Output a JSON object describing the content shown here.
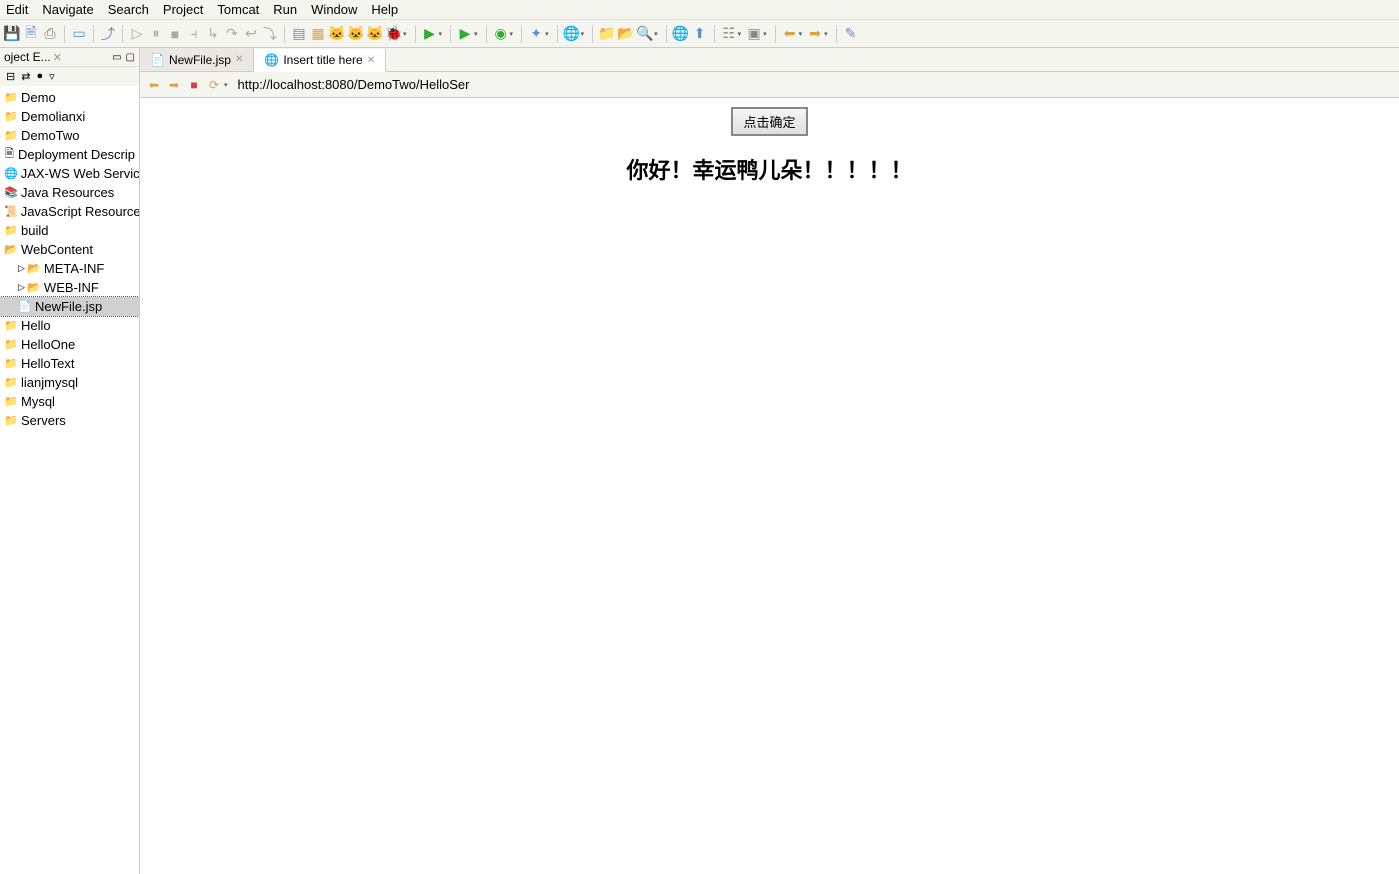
{
  "menu": [
    "Edit",
    "Navigate",
    "Search",
    "Project",
    "Tomcat",
    "Run",
    "Window",
    "Help"
  ],
  "sidebar": {
    "title": "oject E...",
    "items": [
      {
        "label": "Demo",
        "indent": 0,
        "icon": "proj"
      },
      {
        "label": "Demolianxi",
        "indent": 0,
        "icon": "proj"
      },
      {
        "label": "DemoTwo",
        "indent": 0,
        "icon": "proj"
      },
      {
        "label": "Deployment Descrip",
        "indent": 0,
        "icon": "desc"
      },
      {
        "label": "JAX-WS Web Servic",
        "indent": 0,
        "icon": "ws"
      },
      {
        "label": "Java Resources",
        "indent": 0,
        "icon": "java"
      },
      {
        "label": "JavaScript Resource",
        "indent": 0,
        "icon": "js"
      },
      {
        "label": "build",
        "indent": 0,
        "icon": "folder"
      },
      {
        "label": "WebContent",
        "indent": 0,
        "icon": "folder-open"
      },
      {
        "label": "META-INF",
        "indent": 1,
        "icon": "folder-e",
        "pre": "▷"
      },
      {
        "label": "WEB-INF",
        "indent": 1,
        "icon": "folder-e",
        "pre": "▷"
      },
      {
        "label": "NewFile.jsp",
        "indent": 1,
        "icon": "file",
        "selected": true
      },
      {
        "label": "Hello",
        "indent": 0,
        "icon": "proj"
      },
      {
        "label": "HelloOne",
        "indent": 0,
        "icon": "proj"
      },
      {
        "label": "HelloText",
        "indent": 0,
        "icon": "proj"
      },
      {
        "label": "lianjmysql",
        "indent": 0,
        "icon": "proj"
      },
      {
        "label": "Mysql",
        "indent": 0,
        "icon": "proj"
      },
      {
        "label": "Servers",
        "indent": 0,
        "icon": "proj"
      }
    ]
  },
  "tabs": [
    {
      "label": "NewFile.jsp",
      "icon": "file",
      "active": false
    },
    {
      "label": "Insert title here",
      "icon": "globe",
      "active": true
    }
  ],
  "browser": {
    "url": "http://localhost:8080/DemoTwo/HelloSer"
  },
  "page": {
    "button_label": "点击确定",
    "heading": "你好！幸运鸭儿朵！！！！！"
  }
}
